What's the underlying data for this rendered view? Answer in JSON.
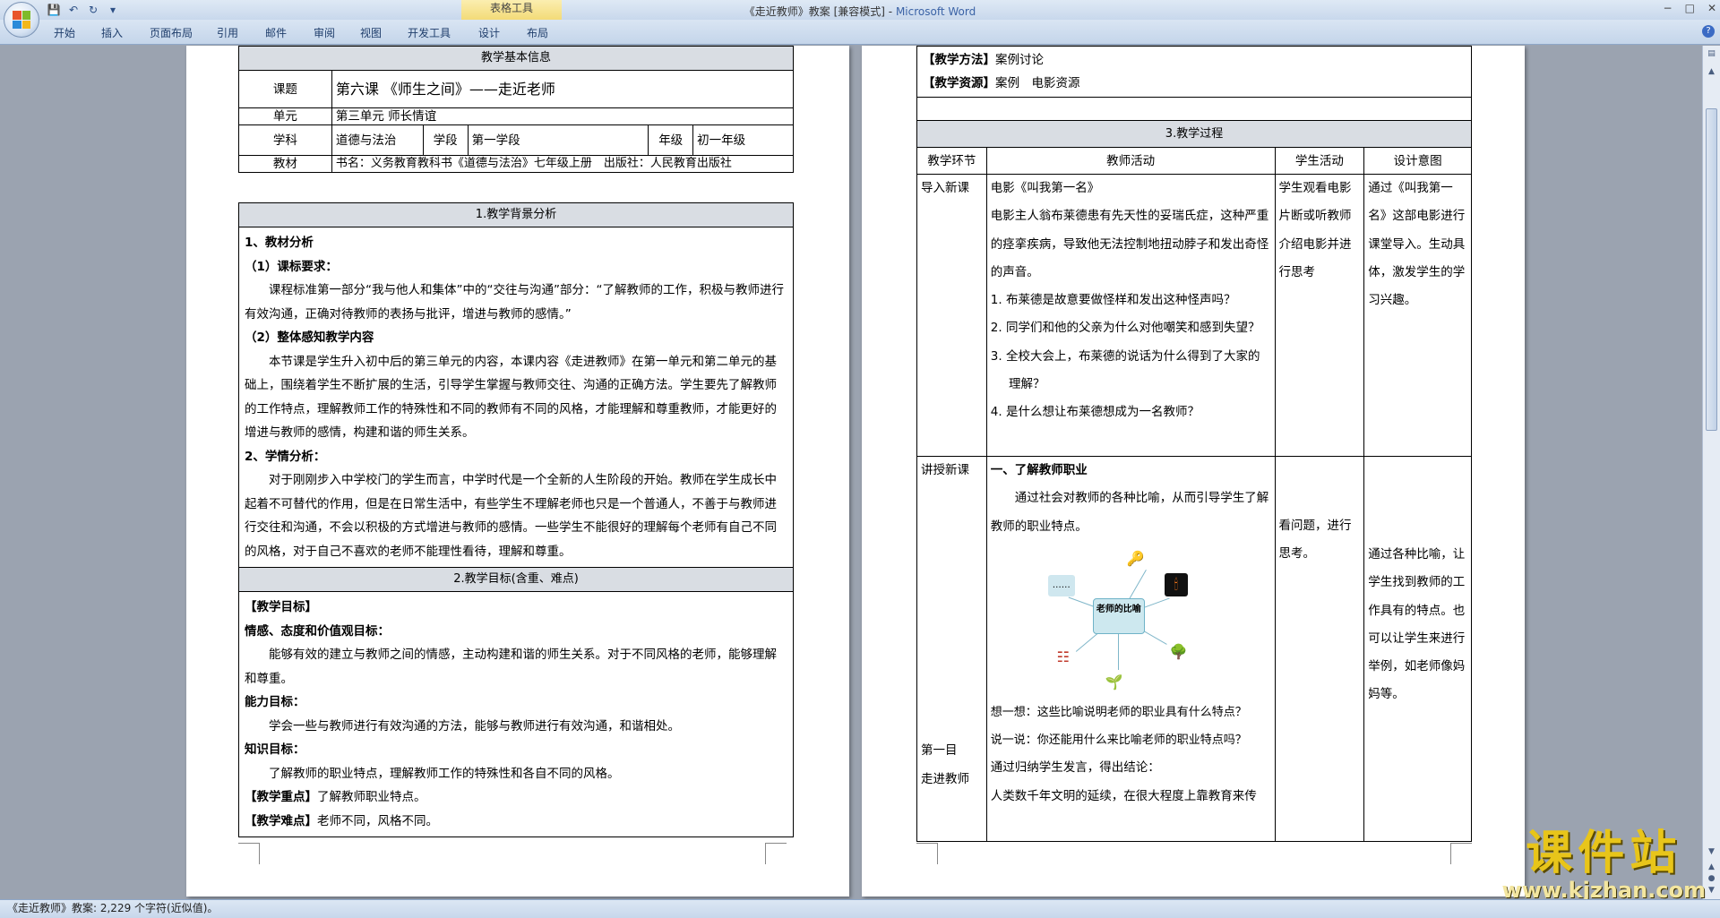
{
  "window": {
    "title_doc": "《走近教师》教案 [兼容模式]",
    "title_app": "Microsoft Word",
    "context_tab_group": "表格工具",
    "controls": [
      "−",
      "□",
      "✕"
    ],
    "help": "?"
  },
  "ribbon": {
    "tabs": [
      "开始",
      "插入",
      "页面布局",
      "引用",
      "邮件",
      "审阅",
      "视图",
      "开发工具",
      "设计",
      "布局"
    ]
  },
  "status": {
    "text": "《走近教师》教案: 2,229 个字符(近似值)。"
  },
  "page1": {
    "basic": {
      "header": "教学基本信息",
      "topic_label": "课题",
      "topic_value": "第六课 《师生之间》——走近老师",
      "unit_label": "单元",
      "unit_value": "第三单元 师长情谊",
      "subject_label": "学科",
      "subject_value": "道德与法治",
      "stage_label": "学段",
      "stage_value": "第一学段",
      "grade_label": "年级",
      "grade_value": "初一年级",
      "textbook_label": "教材",
      "textbook_value": "书名：义务教育教科书《道德与法治》七年级上册　出版社：人民教育出版社"
    },
    "background": {
      "header": "1.教学背景分析",
      "h1": "1、教材分析",
      "h1a": "（1）课标要求：",
      "p1": "课程标准第一部分“我与他人和集体”中的“交往与沟通”部分：“了解教师的工作，积极与教师进行有效沟通，正确对待教师的表扬与批评，增进与教师的感情。”",
      "h1b": "（2）整体感知教学内容",
      "p2": "本节课是学生升入初中后的第三单元的内容，本课内容《走进教师》在第一单元和第二单元的基础上，围绕着学生不断扩展的生活，引导学生掌握与教师交往、沟通的正确方法。学生要先了解教师的工作特点，理解教师工作的特殊性和不同的教师有不同的风格，才能理解和尊重教师，才能更好的增进与教师的感情，构建和谐的师生关系。",
      "h2": "2、学情分析：",
      "p3": "对于刚刚步入中学校门的学生而言，中学时代是一个全新的人生阶段的开始。教师在学生成长中起着不可替代的作用，但是在日常生活中，有些学生不理解老师也只是一个普通人，不善于与教师进行交往和沟通，不会以积极的方式增进与教师的感情。一些学生不能很好的理解每个老师有自己不同的风格，对于自己不喜欢的老师不能理性看待，理解和尊重。"
    },
    "goals": {
      "header": "2.教学目标(含重、难点)",
      "g_title": "【教学目标】",
      "emotion_h": "情感、态度和价值观目标：",
      "emotion_p": "能够有效的建立与教师之间的情感，主动构建和谐的师生关系。对于不同风格的老师，能够理解和尊重。",
      "ability_h": "能力目标：",
      "ability_p": "学会一些与教师进行有效沟通的方法，能够与教师进行有效沟通，和谐相处。",
      "knowledge_h": "知识目标：",
      "knowledge_p": "了解教师的职业特点，理解教师工作的特殊性和各自不同的风格。",
      "key_label": "【教学重点】",
      "key_value": "了解教师职业特点。",
      "diff_label": "【教学难点】",
      "diff_value": "老师不同，风格不同。"
    }
  },
  "page2": {
    "method_label": "【教学方法】",
    "method_value": "案例讨论",
    "resource_label": "【教学资源】",
    "resource_value": "案例　电影资源",
    "process_header": "3.教学过程",
    "col_headers": [
      "教学环节",
      "教师活动",
      "学生活动",
      "设计意图"
    ],
    "row1": {
      "stage": "导入新课",
      "teacher_title": "电影《叫我第一名》",
      "teacher_p": "电影主人翁布莱德患有先天性的妥瑞氏症，这种严重的痉挛疾病，导致他无法控制地扭动脖子和发出奇怪的声音。",
      "questions": [
        "1. 布莱德是故意要做怪样和发出这种怪声吗？",
        "2. 同学们和他的父亲为什么对他嘲笑和感到失望？",
        "3. 全校大会上，布莱德的说话为什么得到了大家的理解？",
        "4. 是什么想让布莱德想成为一名教师？"
      ],
      "student": "学生观看电影片断或听教师介绍电影并进行思考",
      "intent": "通过《叫我第一名》这部电影进行课堂导入。生动具体，激发学生的学习兴趣。"
    },
    "row2": {
      "stage": "讲授新课",
      "stage2a": "第一目",
      "stage2b": "走进教师",
      "teacher_h": "一、了解教师职业",
      "teacher_p": "通过社会对教师的各种比喻，从而引导学生了解教师的职业特点。",
      "mindmap_center": "老师的比喻",
      "mindmap_dots": "……",
      "think": "想一想：这些比喻说明老师的职业具有什么特点？",
      "say": "说一说：你还能用什么来比喻老师的职业特点吗？",
      "conclude": "通过归纳学生发言，得出结论：",
      "last": "人类数千年文明的延续，在很大程度上靠教育来传",
      "student": "看问题，进行思考。",
      "intent": "通过各种比喻，让学生找到教师的工作具有的特点。也可以让学生来进行举例，如老师像妈妈等。"
    }
  },
  "watermark": {
    "big": "课件站",
    "url": "www.kjzhan.com"
  }
}
